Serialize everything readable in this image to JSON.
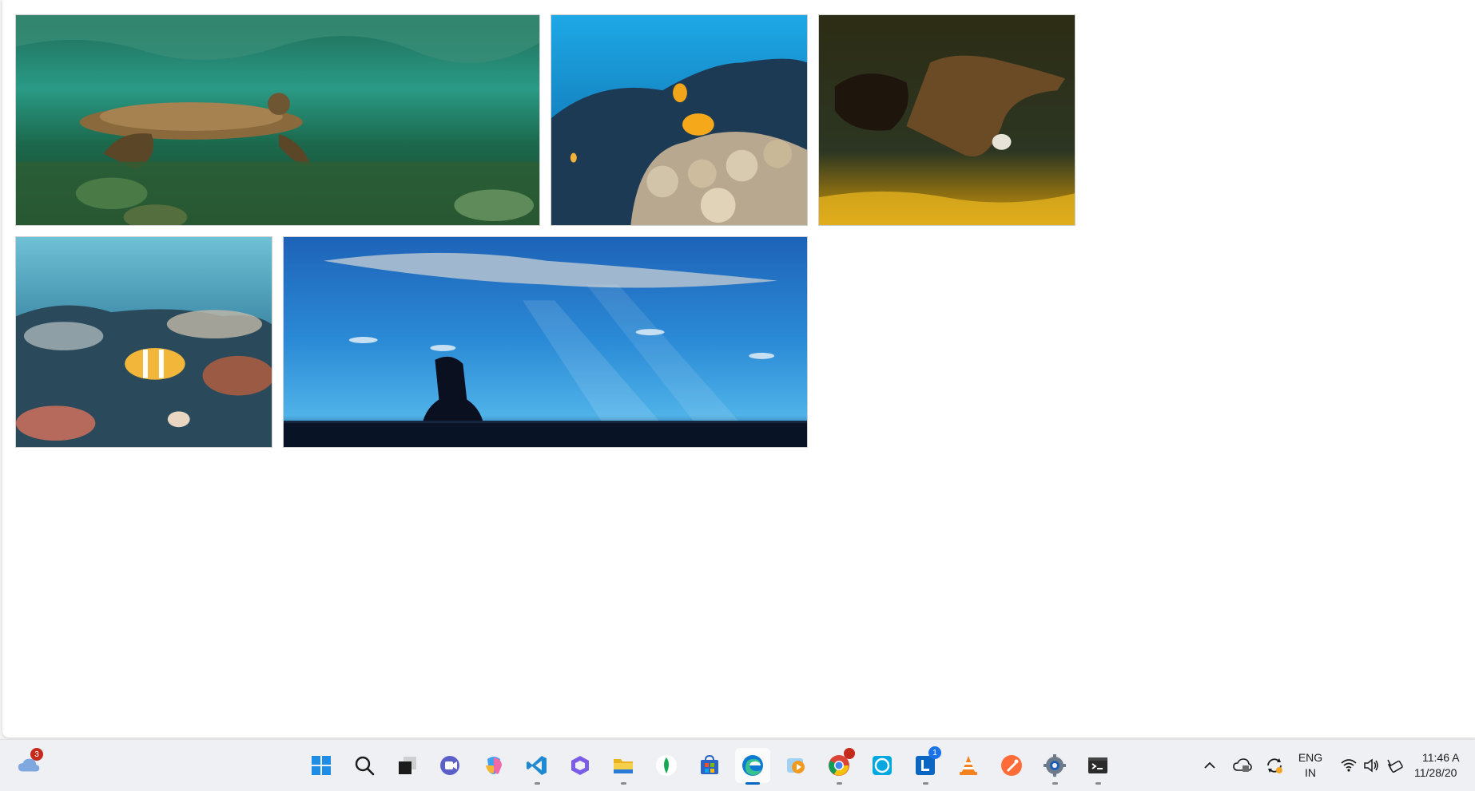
{
  "gallery": {
    "photos": [
      {
        "name": "sea-turtle-photo"
      },
      {
        "name": "coral-reef-fish-photo"
      },
      {
        "name": "underwater-woman-photo"
      },
      {
        "name": "butterflyfish-coral-photo"
      },
      {
        "name": "aquarium-whale-shark-photo"
      }
    ]
  },
  "taskbar": {
    "weather_badge": "3",
    "apps": [
      {
        "icon": "start-windows-icon"
      },
      {
        "icon": "search-icon"
      },
      {
        "icon": "task-view-icon"
      },
      {
        "icon": "teams-meet-icon"
      },
      {
        "icon": "copilot-icon"
      },
      {
        "icon": "vscode-icon"
      },
      {
        "icon": "m365-copilot-icon"
      },
      {
        "icon": "file-explorer-icon"
      },
      {
        "icon": "mongodb-compass-icon"
      },
      {
        "icon": "microsoft-store-icon"
      },
      {
        "icon": "edge-browser-icon"
      },
      {
        "icon": "media-player-icon"
      },
      {
        "icon": "chrome-icon"
      },
      {
        "icon": "alexa-icon"
      },
      {
        "icon": "linkedin-learning-icon",
        "badge": "1"
      },
      {
        "icon": "vlc-icon"
      },
      {
        "icon": "postman-icon"
      },
      {
        "icon": "settings-gear-icon"
      },
      {
        "icon": "terminal-icon"
      }
    ],
    "tray": {
      "language_top": "ENG",
      "language_bottom": "IN",
      "time": "11:46 A",
      "date": "11/28/20"
    }
  },
  "colors": {
    "accent": "#0067c0",
    "badge_red": "#c42b1c",
    "badge_blue": "#1a73e8"
  }
}
